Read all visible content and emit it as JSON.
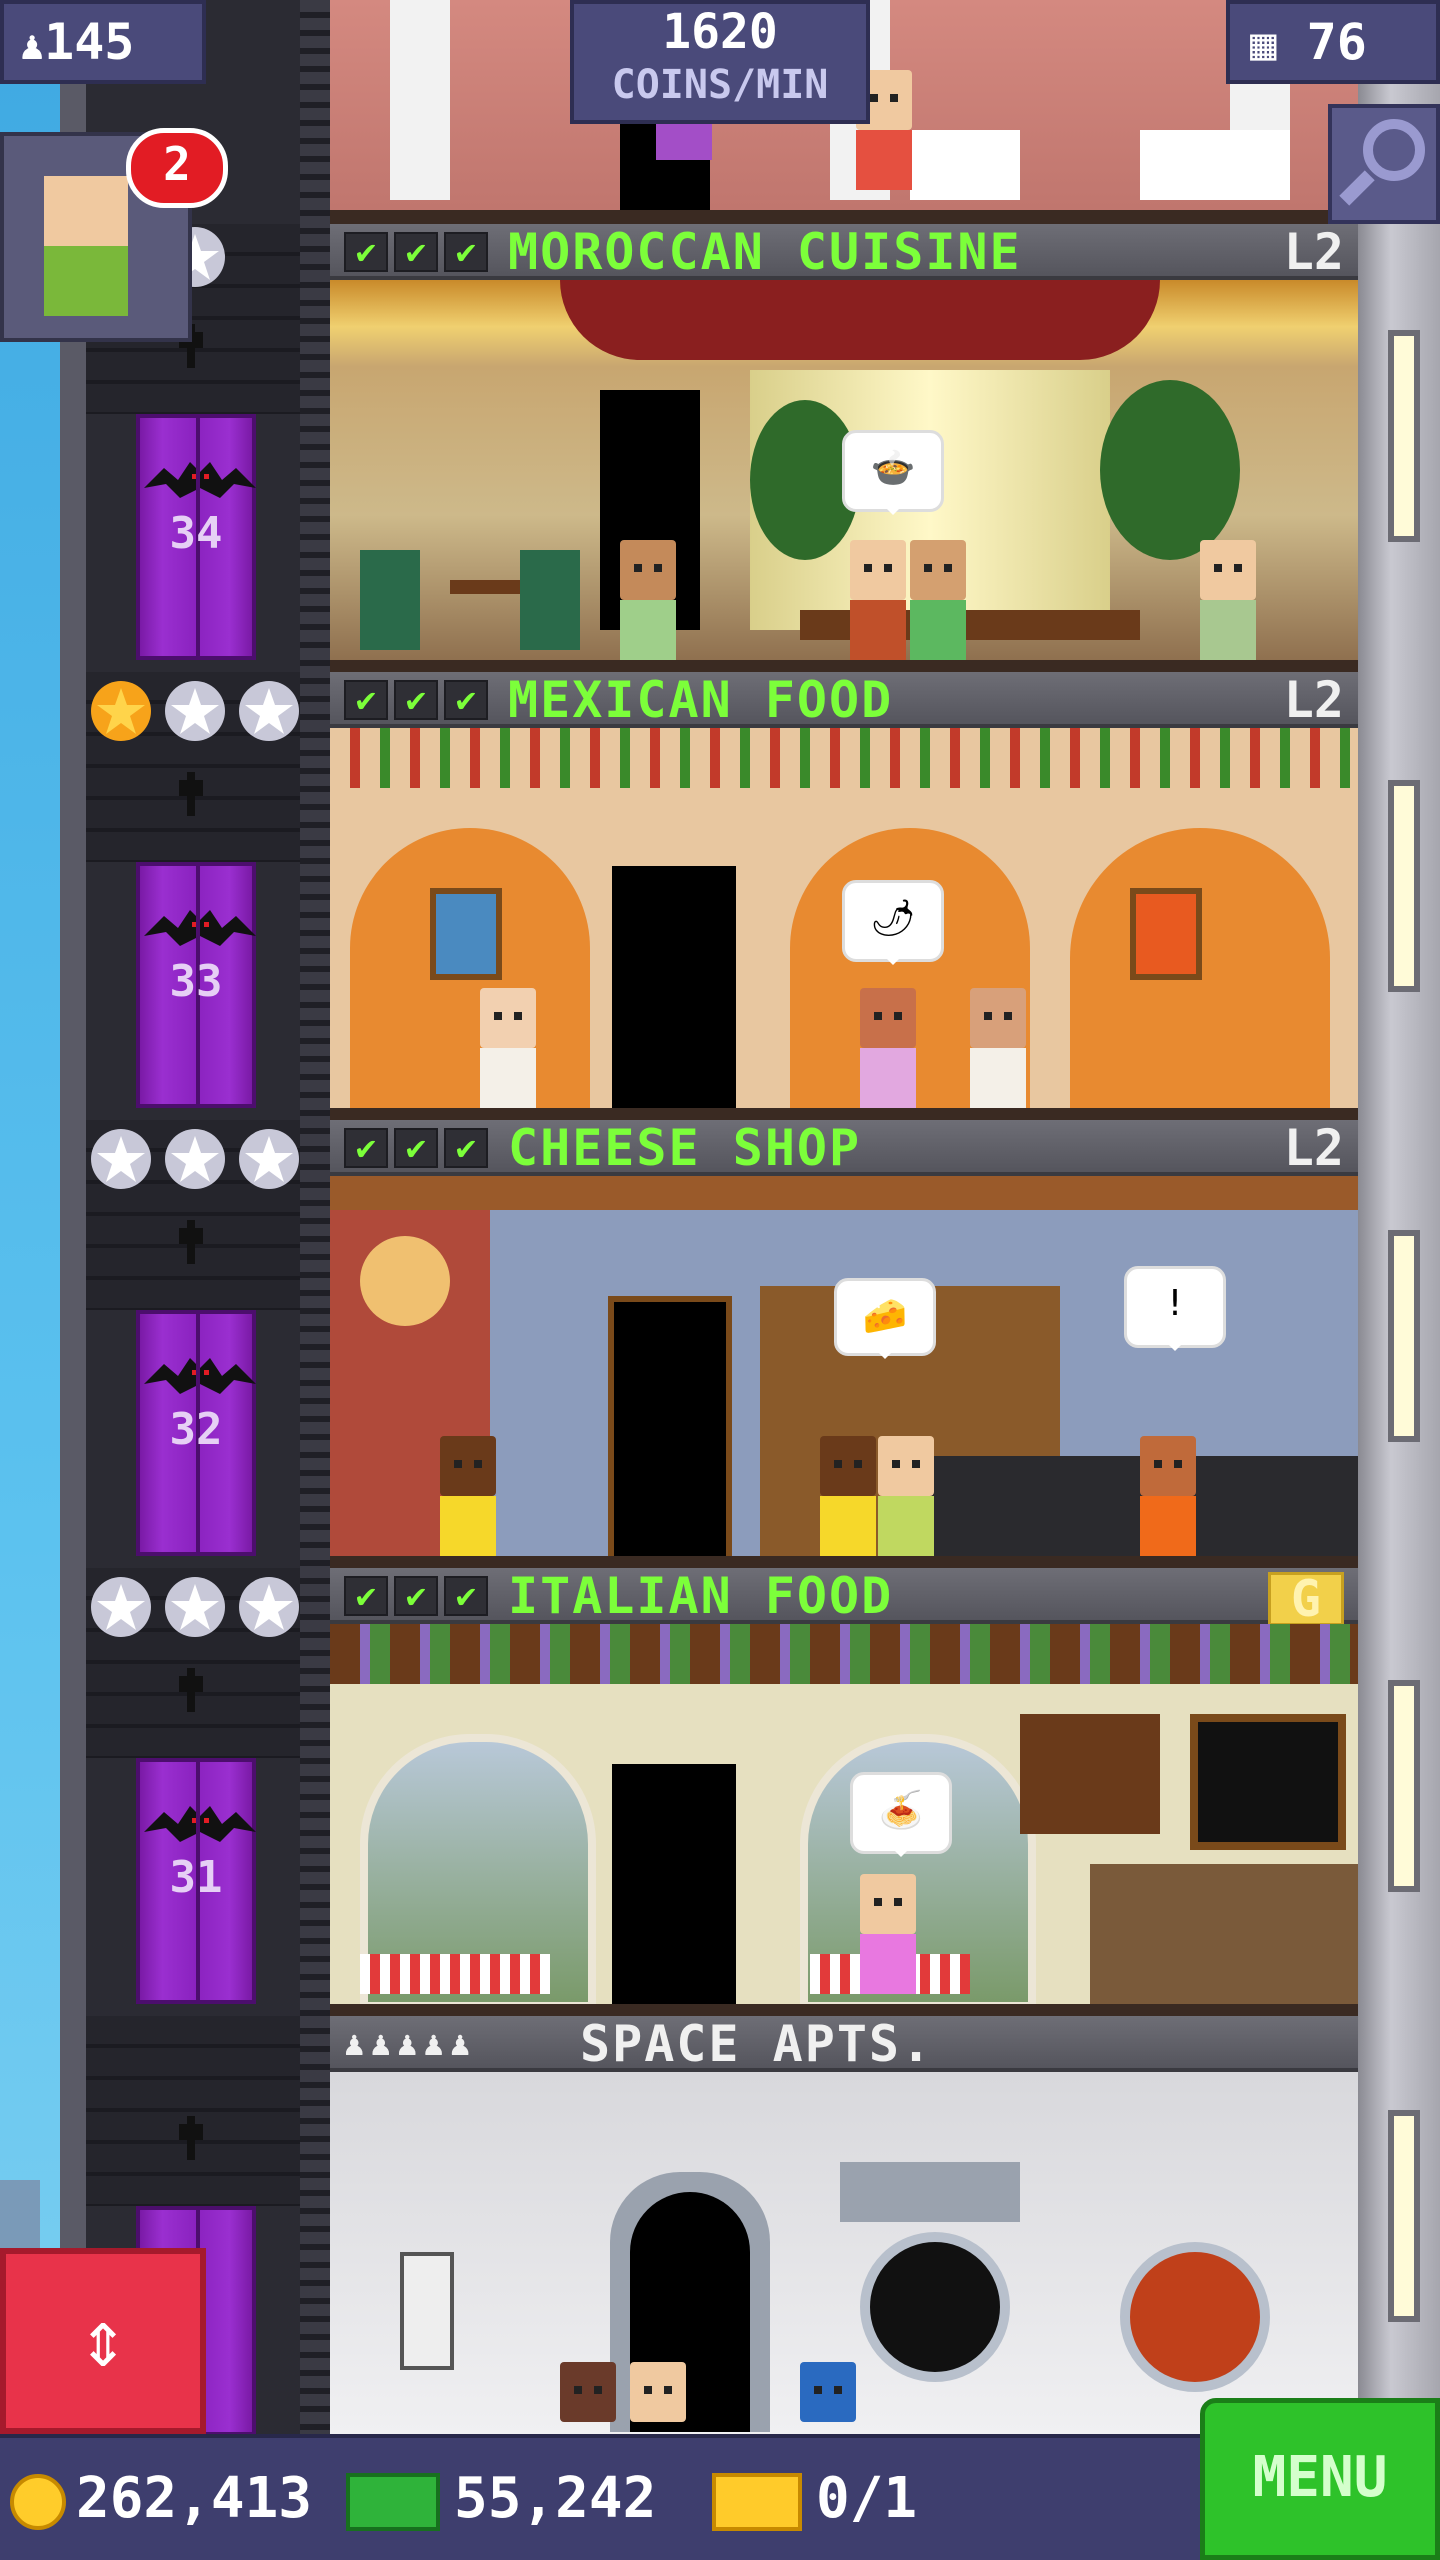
{
  "hud": {
    "population": "145",
    "coins_per_min_value": "1620",
    "coins_per_min_unit": "COINS/MIN",
    "floor_count": "76",
    "visitor_badge": "2"
  },
  "elevator": {
    "floor_numbers": [
      "34",
      "33",
      "32",
      "31"
    ]
  },
  "floors": [
    {
      "name": "MOROCCAN CUISINE",
      "level": "L2",
      "stars_gold": 0
    },
    {
      "name": "MEXICAN FOOD",
      "level": "L2",
      "stars_gold": 1
    },
    {
      "name": "CHEESE SHOP",
      "level": "L2",
      "stars_gold": 0
    },
    {
      "name": "ITALIAN FOOD",
      "level": "G",
      "stars_gold": 0
    },
    {
      "name": "SPACE APTS.",
      "level": ""
    }
  ],
  "bottom_bar": {
    "coins": "262,413",
    "bux": "55,242",
    "tickets": "0/1",
    "menu_label": "MENU"
  },
  "colors": {
    "accent_green": "#7cff3a",
    "elevator_purple": "#9a2fd0",
    "hud_blue": "#4a4a7a",
    "menu_green": "#2ec22a",
    "elevator_button_red": "#e8334a"
  }
}
